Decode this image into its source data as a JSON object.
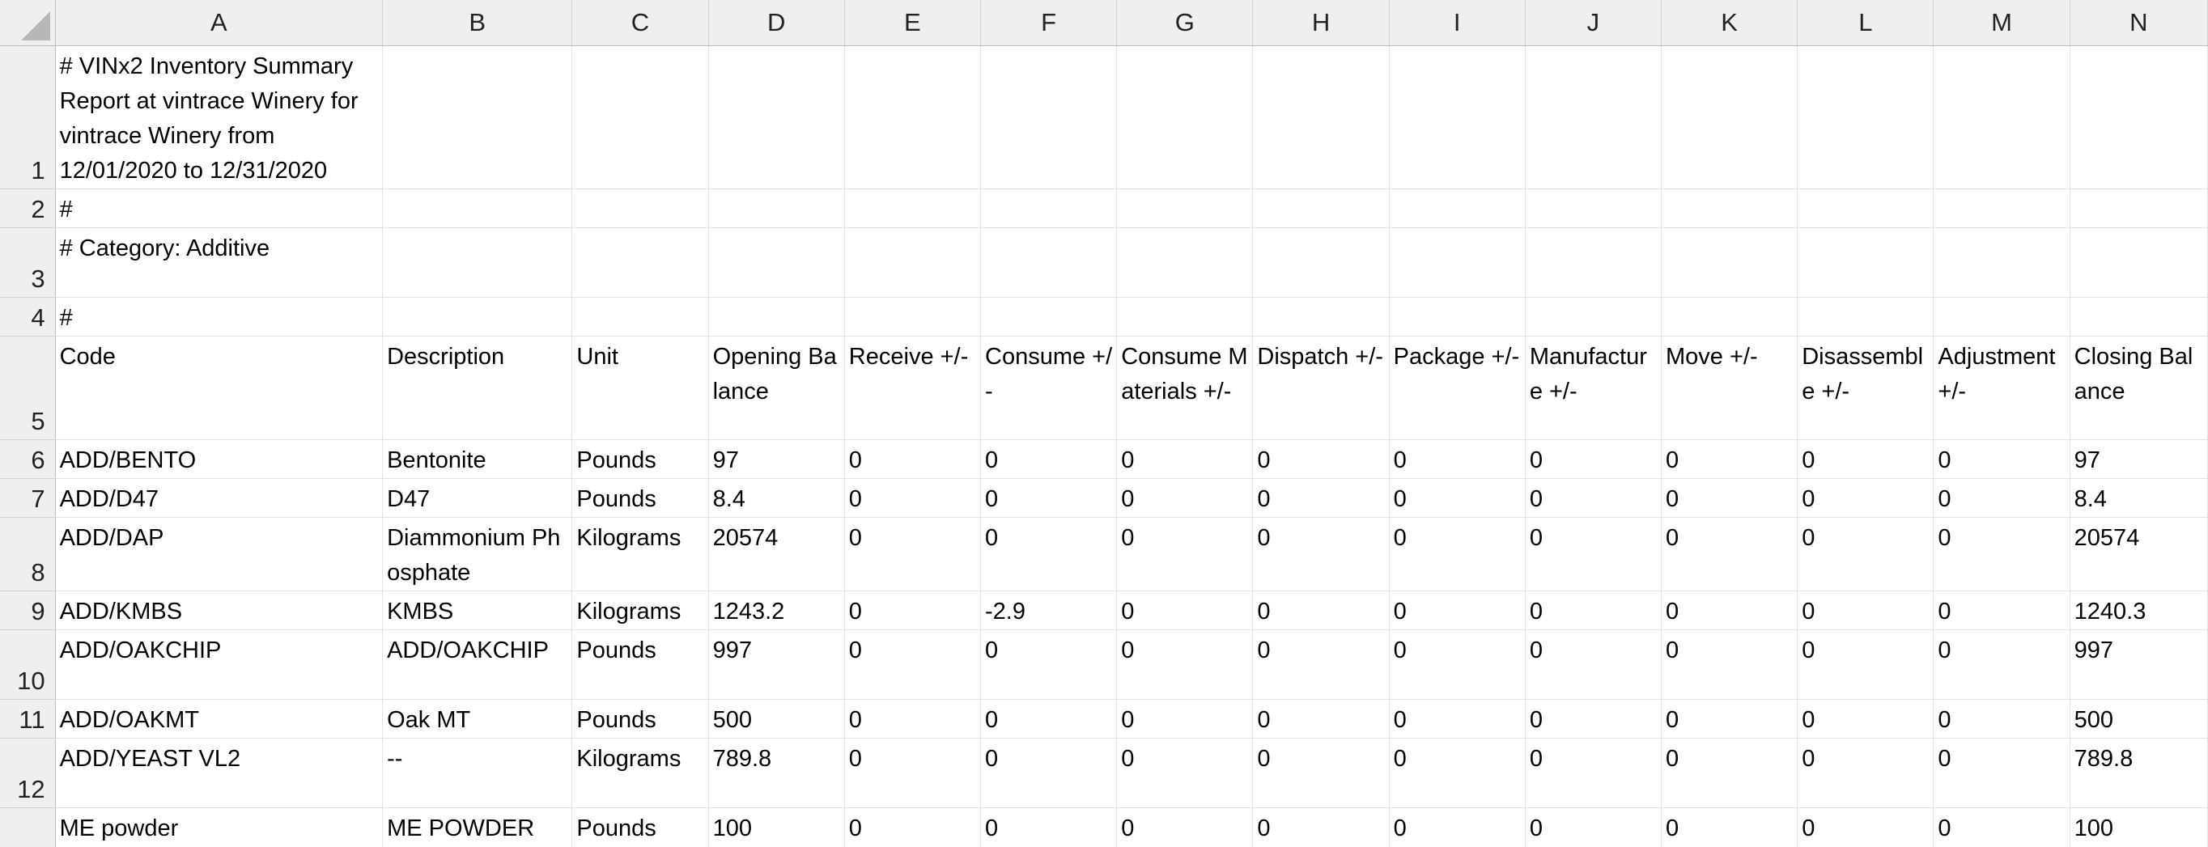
{
  "columns": [
    "A",
    "B",
    "C",
    "D",
    "E",
    "F",
    "G",
    "H",
    "I",
    "J",
    "K",
    "L",
    "M",
    "N"
  ],
  "rows": [
    {
      "num": "1",
      "cells": [
        "#  VINx2 Inventory Summary Report at vintrace Winery for vintrace Winery from 12/01/2020 to 12/31/2020",
        "",
        "",
        "",
        "",
        "",
        "",
        "",
        "",
        "",
        "",
        "",
        "",
        ""
      ]
    },
    {
      "num": "2",
      "cells": [
        "#",
        "",
        "",
        "",
        "",
        "",
        "",
        "",
        "",
        "",
        "",
        "",
        "",
        ""
      ]
    },
    {
      "num": "3",
      "cells": [
        "#  Category: Additive",
        "",
        "",
        "",
        "",
        "",
        "",
        "",
        "",
        "",
        "",
        "",
        "",
        ""
      ]
    },
    {
      "num": "4",
      "cells": [
        "#",
        "",
        "",
        "",
        "",
        "",
        "",
        "",
        "",
        "",
        "",
        "",
        "",
        ""
      ]
    },
    {
      "num": "5",
      "cells": [
        "Code",
        "Description",
        "Unit",
        "Opening Balance",
        "Receive +/-",
        "Consume +/-",
        "Consume Materials +/-",
        "Dispatch +/-",
        "Package +/-",
        "Manufacture +/-",
        "Move +/-",
        "Disassemble +/-",
        "Adjustment +/-",
        "Closing Balance"
      ]
    },
    {
      "num": "6",
      "cells": [
        "ADD/BENTO",
        "Bentonite",
        "Pounds",
        "97",
        "0",
        "0",
        "0",
        "0",
        "0",
        "0",
        "0",
        "0",
        "0",
        "97"
      ]
    },
    {
      "num": "7",
      "cells": [
        "ADD/D47",
        "D47",
        "Pounds",
        "8.4",
        "0",
        "0",
        "0",
        "0",
        "0",
        "0",
        "0",
        "0",
        "0",
        "8.4"
      ]
    },
    {
      "num": "8",
      "cells": [
        "ADD/DAP",
        "Diammonium Phosphate",
        "Kilograms",
        "20574",
        "0",
        "0",
        "0",
        "0",
        "0",
        "0",
        "0",
        "0",
        "0",
        "20574"
      ]
    },
    {
      "num": "9",
      "cells": [
        "ADD/KMBS",
        "KMBS",
        "Kilograms",
        "1243.2",
        "0",
        "-2.9",
        "0",
        "0",
        "0",
        "0",
        "0",
        "0",
        "0",
        "1240.3"
      ]
    },
    {
      "num": "10",
      "cells": [
        "ADD/OAKCHIP",
        "ADD/OAKCHIP",
        "Pounds",
        "997",
        "0",
        "0",
        "0",
        "0",
        "0",
        "0",
        "0",
        "0",
        "0",
        "997"
      ]
    },
    {
      "num": "11",
      "cells": [
        "ADD/OAKMT",
        "Oak MT",
        "Pounds",
        "500",
        "0",
        "0",
        "0",
        "0",
        "0",
        "0",
        "0",
        "0",
        "0",
        "500"
      ]
    },
    {
      "num": "12",
      "cells": [
        "ADD/YEAST VL2",
        "--",
        "Kilograms",
        "789.8",
        "0",
        "0",
        "0",
        "0",
        "0",
        "0",
        "0",
        "0",
        "0",
        "789.8"
      ]
    },
    {
      "num": "13",
      "cells": [
        "ME powder",
        "ME POWDER",
        "Pounds",
        "100",
        "0",
        "0",
        "0",
        "0",
        "0",
        "0",
        "0",
        "0",
        "0",
        "100"
      ]
    }
  ]
}
